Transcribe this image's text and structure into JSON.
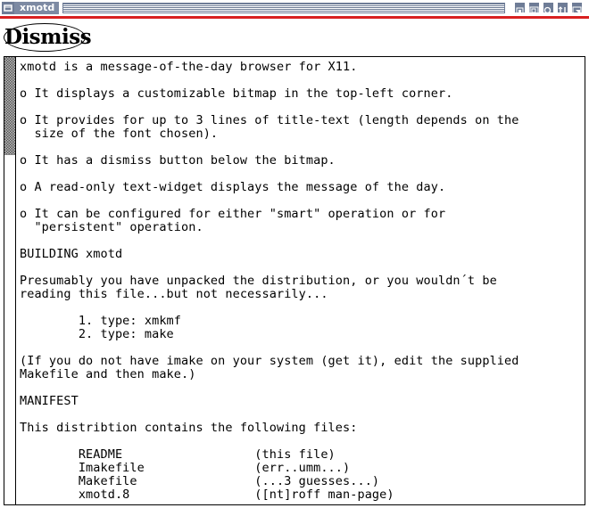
{
  "window": {
    "title": "xmotd"
  },
  "dismiss": {
    "label": "Dismiss"
  },
  "message": {
    "lines": [
      "xmotd is a message-of-the-day browser for X11.",
      "",
      "o It displays a customizable bitmap in the top-left corner.",
      "",
      "o It provides for up to 3 lines of title-text (length depends on the",
      "  size of the font chosen).",
      "",
      "o It has a dismiss button below the bitmap.",
      "",
      "o A read-only text-widget displays the message of the day.",
      "",
      "o It can be configured for either \"smart\" operation or for",
      "  \"persistent\" operation.",
      "",
      "BUILDING xmotd",
      "",
      "Presumably you have unpacked the distribution, or you wouldn´t be",
      "reading this file...but not necessarily...",
      "",
      "        1. type: xmkmf",
      "        2. type: make",
      "",
      "(If you do not have imake on your system (get it), edit the supplied",
      "Makefile and then make.)",
      "",
      "MANIFEST",
      "",
      "This distribtion contains the following files:",
      "",
      "        README                  (this file)",
      "        Imakefile               (err..umm...)",
      "        Makefile                (...3 guesses...)",
      "        xmotd.8                 ([nt]roff man-page)"
    ]
  },
  "colors": {
    "accent": "#d82020",
    "titlebar": "#6e7c96"
  }
}
